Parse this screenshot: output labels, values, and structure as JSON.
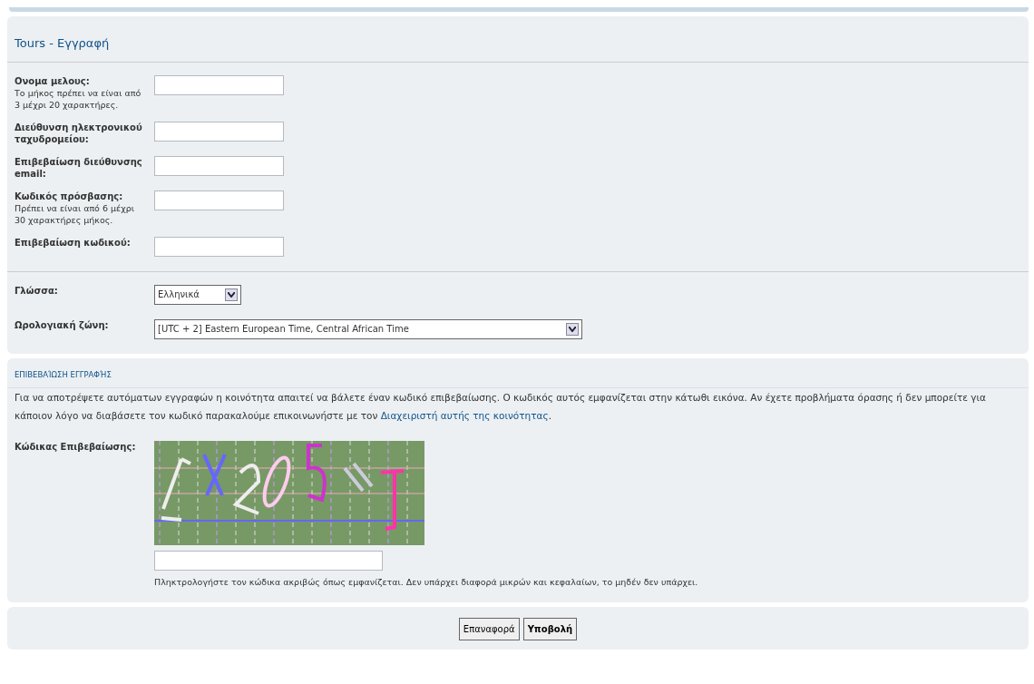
{
  "title": "Tours - Εγγραφή",
  "account_fields": [
    {
      "label": "Ονομα μελους:",
      "hint": "Το μήκος πρέπει να είναι από 3 μέχρι 20 χαρακτήρες."
    },
    {
      "label": "Διεύθυνση ηλεκτρονικού ταχυδρομείου:"
    },
    {
      "label": "Επιβεβαίωση διεύθυνσης email:"
    },
    {
      "label": "Κωδικός πρόσβασης:",
      "hint": "Πρέπει να είναι από 6 μέχρι 30 χαρακτήρες μήκος."
    },
    {
      "label": "Επιβεβαίωση κωδικού:"
    }
  ],
  "preferences": [
    {
      "label": "Γλώσσα:",
      "value": "Ελληνικά"
    },
    {
      "label": "Ωρολογιακή ζώνη:",
      "value": "[UTC + 2] Eastern European Time, Central African Time"
    }
  ],
  "confirmation": {
    "heading": "ΕΠΙΒΕΒΑΊΩΣΗ ΕΓΓΡΑΦΉΣ",
    "text_before": "Για να αποτρέψετε αυτόματων εγγραφών η κοινότητα απαιτεί να βάλετε έναν κωδικό επιβεβαίωσης. Ο κωδικός αυτός εμφανίζεται στην κάτωθι εικόνα. Αν έχετε προβλήματα όρασης ή δεν μπορείτε για κάποιον λόγο να διαβάσετε τον κωδικό παρακαλούμε επικοινωνήστε με τον",
    "link": "Διαχειριστή αυτής της κοινότητας",
    "text_after": ".",
    "code_label": "Κώδικας Επιβεβαίωσης:",
    "code_hint": "Πληκτρολογήστε τον κώδικα ακριβώς όπως εμφανίζεται. Δεν υπάρχει διαφορά μικρών και κεφαλαίων, το μηδέν δεν υπάρχει."
  },
  "buttons": [
    {
      "label": "Επαναφορά",
      "kind": "reset"
    },
    {
      "label": "Υποβολή",
      "kind": "submit"
    }
  ]
}
